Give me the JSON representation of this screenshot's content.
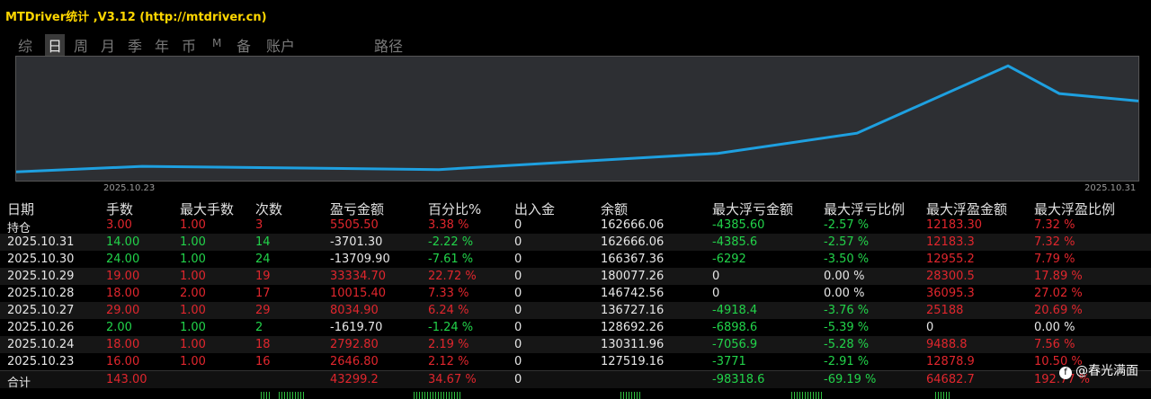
{
  "window": {
    "title": "MTDriver统计 ,V3.12 (http://mtdriver.cn)"
  },
  "tabs": [
    "综",
    "日",
    "周",
    "月",
    "季",
    "年",
    "币",
    "M",
    "备",
    "账户",
    "路径"
  ],
  "active_tab": "日",
  "chart": {
    "date_start": "2025.10.23",
    "date_end": "2025.10.31",
    "line_color": "#1ea0e0",
    "background": "#2d2f33"
  },
  "chart_data": {
    "type": "line",
    "x": [
      "2025.10.23",
      "2025.10.24",
      "2025.10.26",
      "2025.10.27",
      "2025.10.28",
      "2025.10.29",
      "2025.10.30",
      "2025.10.31"
    ],
    "series": [
      {
        "values": [
          127519.16,
          130311.96,
          128692.26,
          136727.16,
          146742.56,
          180077.26,
          166367.36,
          162666.06
        ]
      }
    ]
  },
  "table": {
    "headers": [
      "日期",
      "手数",
      "最大手数",
      "次数",
      "盈亏金额",
      "百分比%",
      "出入金",
      "余额",
      "最大浮亏金额",
      "最大浮亏比例",
      "最大浮盈金额",
      "最大浮盈比例"
    ],
    "rows": [
      [
        "持仓",
        "3.00",
        "1.00",
        "3",
        "5505.50",
        "3.38 %",
        "0",
        "162666.06",
        "-4385.60",
        "-2.57 %",
        "12183.30",
        "7.32 %"
      ],
      [
        "2025.10.31",
        "14.00",
        "1.00",
        "14",
        "-3701.30",
        "-2.22 %",
        "0",
        "162666.06",
        "-4385.6",
        "-2.57 %",
        "12183.3",
        "7.32 %"
      ],
      [
        "2025.10.30",
        "24.00",
        "1.00",
        "24",
        "-13709.90",
        "-7.61 %",
        "0",
        "166367.36",
        "-6292",
        "-3.50 %",
        "12955.2",
        "7.79 %"
      ],
      [
        "2025.10.29",
        "19.00",
        "1.00",
        "19",
        "33334.70",
        "22.72 %",
        "0",
        "180077.26",
        "0",
        "0.00 %",
        "28300.5",
        "17.89 %"
      ],
      [
        "2025.10.28",
        "18.00",
        "2.00",
        "17",
        "10015.40",
        "7.33 %",
        "0",
        "146742.56",
        "0",
        "0.00 %",
        "36095.3",
        "27.02 %"
      ],
      [
        "2025.10.27",
        "29.00",
        "1.00",
        "29",
        "8034.90",
        "6.24 %",
        "0",
        "136727.16",
        "-4918.4",
        "-3.76 %",
        "25188",
        "20.69 %"
      ],
      [
        "2025.10.26",
        "2.00",
        "1.00",
        "2",
        "-1619.70",
        "-1.24 %",
        "0",
        "128692.26",
        "-6898.6",
        "-5.39 %",
        "0",
        "0.00 %"
      ],
      [
        "2025.10.24",
        "18.00",
        "1.00",
        "18",
        "2792.80",
        "2.19 %",
        "0",
        "130311.96",
        "-7056.9",
        "-5.28 %",
        "9488.8",
        "7.56 %"
      ],
      [
        "2025.10.23",
        "16.00",
        "1.00",
        "16",
        "2646.80",
        "2.12 %",
        "0",
        "127519.16",
        "-3771",
        "-2.91 %",
        "12878.9",
        "10.50 %"
      ]
    ],
    "row_colors": [
      [
        "white",
        "red",
        "red",
        "red",
        "red",
        "red",
        "white",
        "white",
        "green",
        "green",
        "red",
        "red"
      ],
      [
        "white",
        "green",
        "green",
        "green",
        "white",
        "green",
        "white",
        "white",
        "green",
        "green",
        "red",
        "red"
      ],
      [
        "white",
        "green",
        "green",
        "green",
        "white",
        "green",
        "white",
        "white",
        "green",
        "green",
        "red",
        "red"
      ],
      [
        "white",
        "red",
        "red",
        "red",
        "red",
        "red",
        "white",
        "white",
        "white",
        "white",
        "red",
        "red"
      ],
      [
        "white",
        "red",
        "red",
        "red",
        "red",
        "red",
        "white",
        "white",
        "white",
        "white",
        "red",
        "red"
      ],
      [
        "white",
        "red",
        "red",
        "red",
        "red",
        "red",
        "white",
        "white",
        "green",
        "green",
        "red",
        "red"
      ],
      [
        "white",
        "green",
        "green",
        "green",
        "white",
        "green",
        "white",
        "white",
        "green",
        "green",
        "white",
        "white"
      ],
      [
        "white",
        "red",
        "red",
        "red",
        "red",
        "red",
        "white",
        "white",
        "green",
        "green",
        "red",
        "red"
      ],
      [
        "white",
        "red",
        "red",
        "red",
        "red",
        "red",
        "white",
        "white",
        "green",
        "green",
        "red",
        "red"
      ]
    ],
    "total": [
      "合计",
      "143.00",
      "",
      "",
      "43299.2",
      "34.67 %",
      "0",
      "",
      "-98318.6",
      "-69.19 %",
      "64682.7",
      "192.77 %"
    ],
    "total_colors": [
      "white",
      "red",
      "white",
      "white",
      "red",
      "red",
      "white",
      "white",
      "green",
      "green",
      "red",
      "red"
    ]
  },
  "watermark": {
    "icon": "weibo-like-circle-icon",
    "text": "@春光满面"
  }
}
